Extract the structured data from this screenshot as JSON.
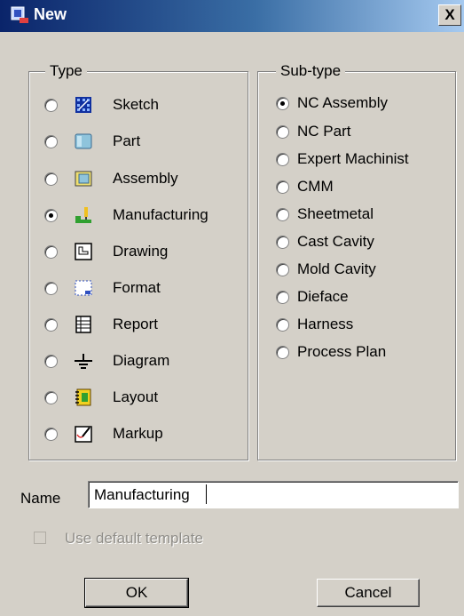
{
  "window": {
    "title": "New",
    "close_label": "X"
  },
  "type_group": {
    "legend": "Type",
    "selected": "Manufacturing",
    "items": [
      {
        "label": "Sketch",
        "icon": "sketch-icon",
        "selected": false
      },
      {
        "label": "Part",
        "icon": "part-icon",
        "selected": false
      },
      {
        "label": "Assembly",
        "icon": "assembly-icon",
        "selected": false
      },
      {
        "label": "Manufacturing",
        "icon": "manufacturing-icon",
        "selected": true
      },
      {
        "label": "Drawing",
        "icon": "drawing-icon",
        "selected": false
      },
      {
        "label": "Format",
        "icon": "format-icon",
        "selected": false
      },
      {
        "label": "Report",
        "icon": "report-icon",
        "selected": false
      },
      {
        "label": "Diagram",
        "icon": "diagram-icon",
        "selected": false
      },
      {
        "label": "Layout",
        "icon": "layout-icon",
        "selected": false
      },
      {
        "label": "Markup",
        "icon": "markup-icon",
        "selected": false
      }
    ]
  },
  "subtype_group": {
    "legend": "Sub-type",
    "selected": "NC Assembly",
    "items": [
      {
        "label": "NC Assembly",
        "selected": true
      },
      {
        "label": "NC Part",
        "selected": false
      },
      {
        "label": "Expert Machinist",
        "selected": false
      },
      {
        "label": "CMM",
        "selected": false
      },
      {
        "label": "Sheetmetal",
        "selected": false
      },
      {
        "label": "Cast Cavity",
        "selected": false
      },
      {
        "label": "Mold Cavity",
        "selected": false
      },
      {
        "label": "Dieface",
        "selected": false
      },
      {
        "label": "Harness",
        "selected": false
      },
      {
        "label": "Process Plan",
        "selected": false
      }
    ]
  },
  "name_field": {
    "label": "Name",
    "value": "Manufacturing"
  },
  "template_checkbox": {
    "label": "Use default template",
    "checked": false,
    "enabled": false
  },
  "buttons": {
    "ok_label": "OK",
    "cancel_label": "Cancel"
  },
  "colors": {
    "title_bar_start": "#0a246a",
    "title_bar_end": "#a6caf0",
    "dialog_face": "#d4d0c8"
  }
}
